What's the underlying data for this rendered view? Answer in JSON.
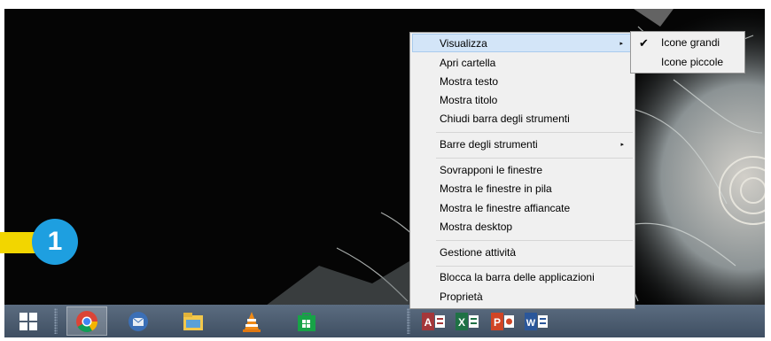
{
  "menu": {
    "items": [
      {
        "label": "Visualizza",
        "submenu": true
      },
      {
        "label": "Apri cartella"
      },
      {
        "label": "Mostra testo"
      },
      {
        "label": "Mostra titolo"
      },
      {
        "label": "Chiudi barra degli strumenti"
      },
      {
        "label": "Barre degli strumenti",
        "submenu": true
      },
      {
        "label": "Sovrapponi le finestre"
      },
      {
        "label": "Mostra le finestre in pila"
      },
      {
        "label": "Mostra le finestre affiancate"
      },
      {
        "label": "Mostra desktop"
      },
      {
        "label": "Gestione attività"
      },
      {
        "label": "Blocca la barra delle applicazioni"
      },
      {
        "label": "Proprietà"
      }
    ],
    "submenu_arrow": "▸"
  },
  "view_submenu": {
    "items": [
      {
        "label": "Icone grandi",
        "checked": true
      },
      {
        "label": "Icone piccole",
        "checked": false
      }
    ],
    "check_glyph": "✔"
  },
  "callout": {
    "number": "1"
  },
  "taskbar": {
    "apps": [
      "start-icon",
      "chrome-icon",
      "thunderbird-icon",
      "file-explorer-icon",
      "vlc-icon",
      "store-icon"
    ],
    "toolbar_apps": [
      {
        "name": "access-icon",
        "letter": "A",
        "color": "#a4373a"
      },
      {
        "name": "excel-icon",
        "letter": "X",
        "color": "#1f7145"
      },
      {
        "name": "powerpoint-icon",
        "letter": "P",
        "color": "#d04525"
      },
      {
        "name": "word-icon",
        "letter": "W",
        "color": "#2b579a"
      }
    ]
  },
  "colors": {
    "highlight": "#d3e5f8",
    "callout": "#1e9fe0",
    "arrow": "#f2d600"
  }
}
